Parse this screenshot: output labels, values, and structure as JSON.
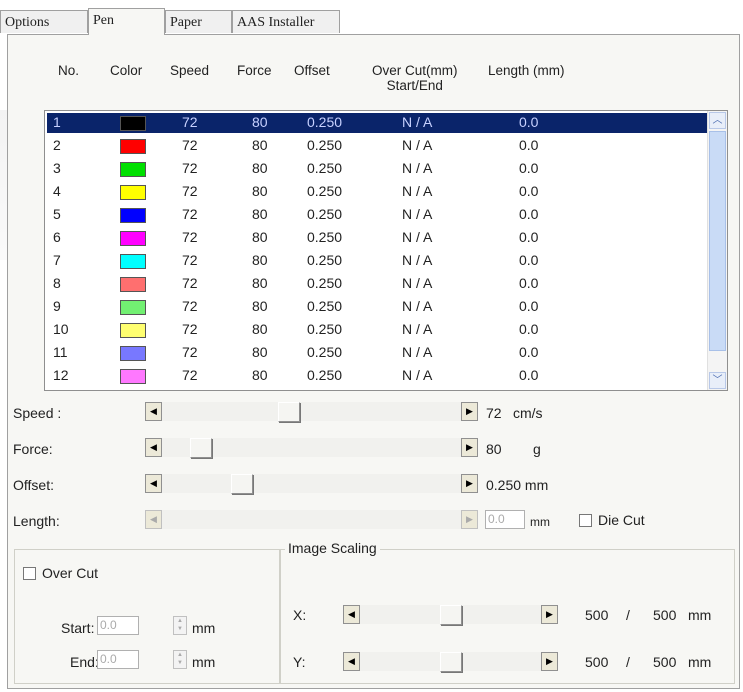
{
  "tabs": [
    {
      "label": "Options"
    },
    {
      "label": "Pen"
    },
    {
      "label": "Paper"
    },
    {
      "label": "AAS Installer"
    }
  ],
  "columns": {
    "no": "No.",
    "color": "Color",
    "speed": "Speed",
    "force": "Force",
    "offset": "Offset",
    "overcut_line1": "Over Cut(mm)",
    "overcut_line2": "Start/End",
    "length": "Length (mm)"
  },
  "pens": [
    {
      "no": "1",
      "color": "#000000",
      "speed": "72",
      "force": "80",
      "offset": "0.250",
      "overcut": "N / A",
      "length": "0.0",
      "selected": true
    },
    {
      "no": "2",
      "color": "#ff0000",
      "speed": "72",
      "force": "80",
      "offset": "0.250",
      "overcut": "N / A",
      "length": "0.0"
    },
    {
      "no": "3",
      "color": "#00e000",
      "speed": "72",
      "force": "80",
      "offset": "0.250",
      "overcut": "N / A",
      "length": "0.0"
    },
    {
      "no": "4",
      "color": "#ffff00",
      "speed": "72",
      "force": "80",
      "offset": "0.250",
      "overcut": "N / A",
      "length": "0.0"
    },
    {
      "no": "5",
      "color": "#0000ff",
      "speed": "72",
      "force": "80",
      "offset": "0.250",
      "overcut": "N / A",
      "length": "0.0"
    },
    {
      "no": "6",
      "color": "#ff00ff",
      "speed": "72",
      "force": "80",
      "offset": "0.250",
      "overcut": "N / A",
      "length": "0.0"
    },
    {
      "no": "7",
      "color": "#00ffff",
      "speed": "72",
      "force": "80",
      "offset": "0.250",
      "overcut": "N / A",
      "length": "0.0"
    },
    {
      "no": "8",
      "color": "#ff6f6f",
      "speed": "72",
      "force": "80",
      "offset": "0.250",
      "overcut": "N / A",
      "length": "0.0"
    },
    {
      "no": "9",
      "color": "#72f072",
      "speed": "72",
      "force": "80",
      "offset": "0.250",
      "overcut": "N / A",
      "length": "0.0"
    },
    {
      "no": "10",
      "color": "#ffff70",
      "speed": "72",
      "force": "80",
      "offset": "0.250",
      "overcut": "N / A",
      "length": "0.0"
    },
    {
      "no": "11",
      "color": "#7878ff",
      "speed": "72",
      "force": "80",
      "offset": "0.250",
      "overcut": "N / A",
      "length": "0.0"
    },
    {
      "no": "12",
      "color": "#ff78ff",
      "speed": "72",
      "force": "80",
      "offset": "0.250",
      "overcut": "N / A",
      "length": "0.0"
    }
  ],
  "sliders": {
    "speed": {
      "label": "Speed :",
      "value": "72",
      "unit": "cm/s",
      "level": 0.42
    },
    "force": {
      "label": "Force:",
      "value": "80",
      "unit": "g",
      "level": 0.1
    },
    "offset": {
      "label": "Offset:",
      "value": "0.250 mm",
      "level": 0.25
    },
    "length": {
      "label": "Length:",
      "value": "0.0",
      "unit": "mm",
      "disabled": true
    }
  },
  "die_cut": {
    "label": "Die Cut",
    "checked": false
  },
  "overcut": {
    "label": "Over Cut",
    "checked": false,
    "start_label": "Start:",
    "start_value": "0.0",
    "start_unit": "mm",
    "end_label": "End:",
    "end_value": "0.0",
    "end_unit": "mm"
  },
  "image_scaling": {
    "title": "Image Scaling",
    "x_label": "X:",
    "x_value": "500",
    "x_sep": "/",
    "x_total": "500",
    "x_unit": "mm",
    "x_level": 0.5,
    "y_label": "Y:",
    "y_value": "500",
    "y_sep": "/",
    "y_total": "500",
    "y_unit": "mm",
    "y_level": 0.5
  },
  "icons": {
    "left_arrow": "◀",
    "right_arrow": "▶",
    "up_arrow": "▲",
    "down_arrow": "▼",
    "scroll_up": "︿",
    "scroll_down": "﹀"
  }
}
